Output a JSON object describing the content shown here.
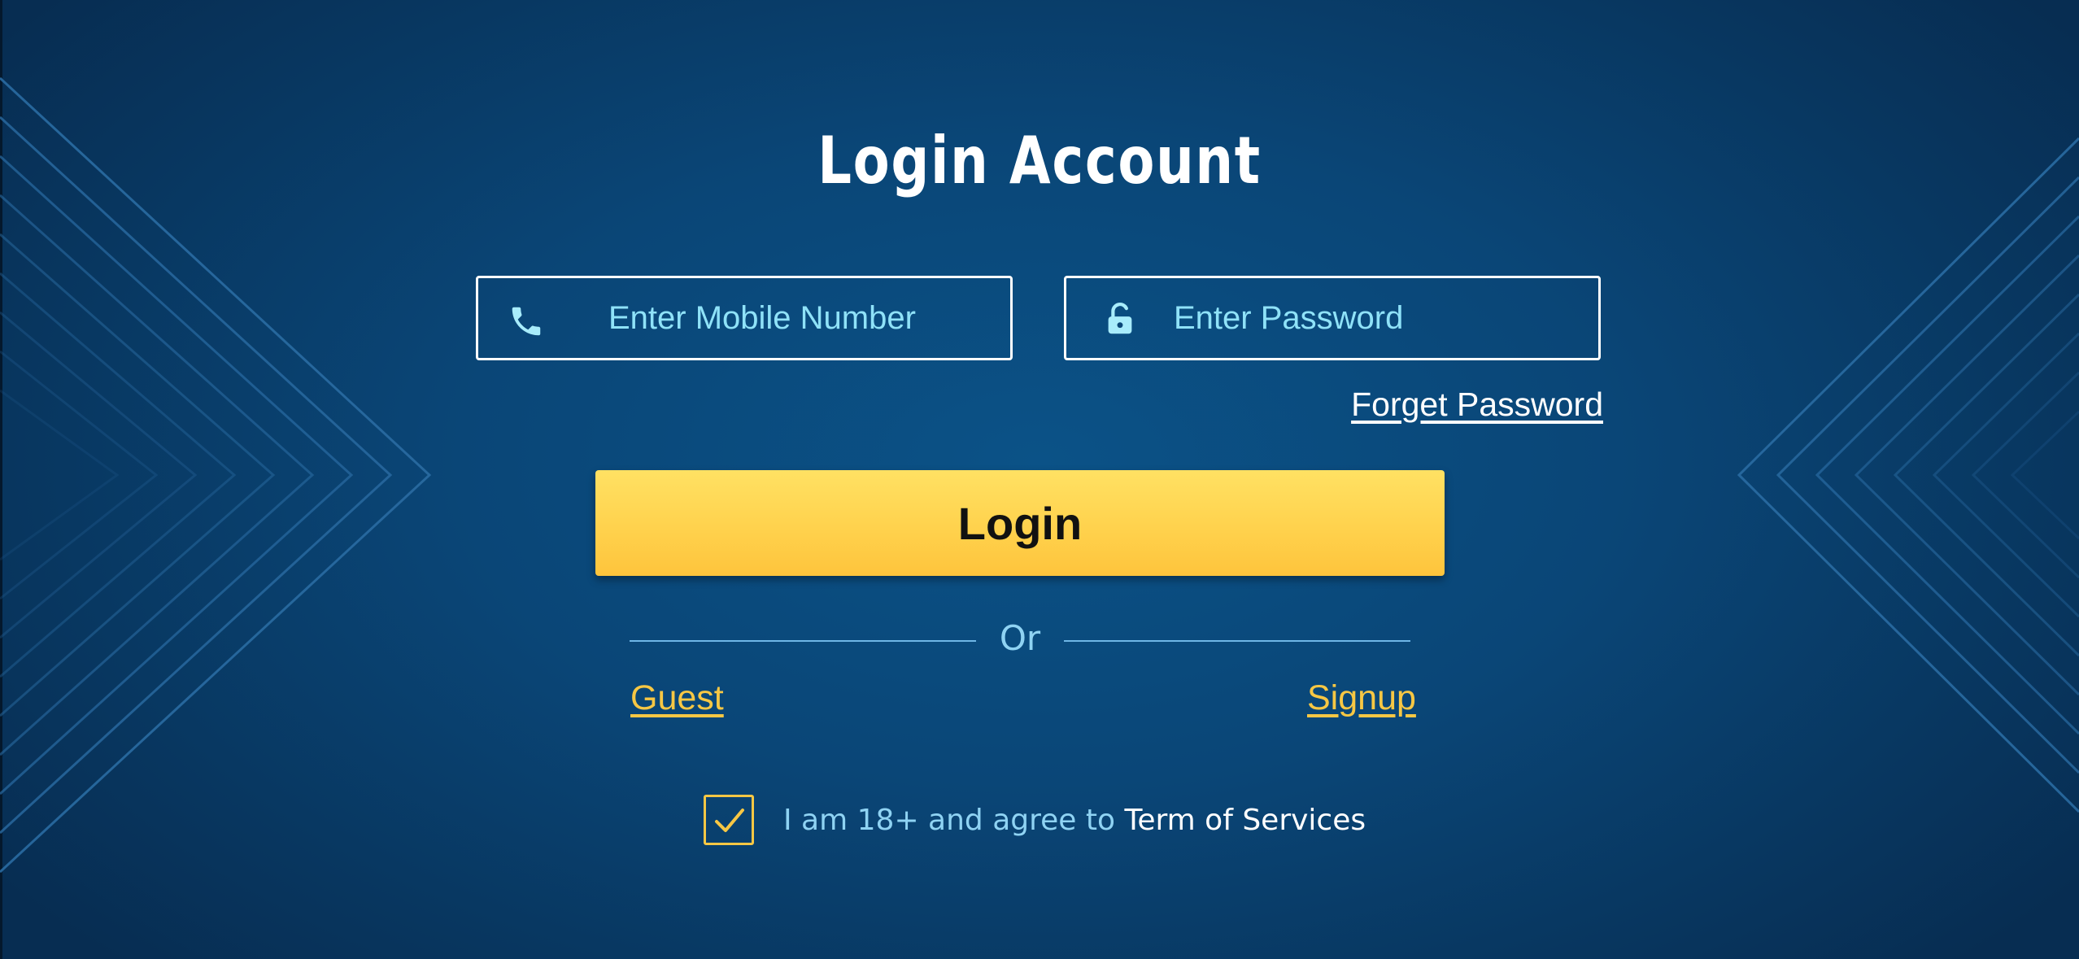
{
  "title": "Login Account",
  "mobile_field": {
    "placeholder": "Enter Mobile Number",
    "value": "",
    "icon": "phone-icon"
  },
  "password_field": {
    "placeholder": "Enter Password",
    "value": "",
    "icon": "unlock-icon"
  },
  "forget_password_label": "Forget Password",
  "login_button_label": "Login",
  "divider_text": "Or",
  "guest_label": "Guest",
  "signup_label": "Signup",
  "agreement": {
    "checked": true,
    "prefix": "I am 18+ and agree to ",
    "terms_label": "Term of Services"
  },
  "colors": {
    "background": "#0a4677",
    "accent_yellow": "#ffd24d",
    "field_text": "#8fe2f8",
    "link_yellow": "#f7c744"
  }
}
